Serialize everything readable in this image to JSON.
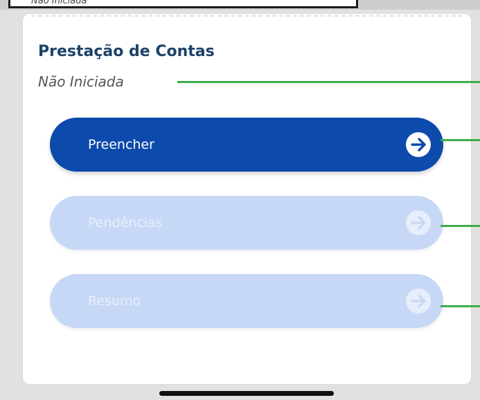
{
  "previous_card": {
    "status_text": "Não Iniciada"
  },
  "card": {
    "title": "Prestação de Contas",
    "status": "Não Iniciada"
  },
  "buttons": [
    {
      "label": "Preencher",
      "state": "enabled",
      "icon": "arrow-right-circle-icon"
    },
    {
      "label": "Pendências",
      "state": "disabled",
      "icon": "arrow-right-circle-icon"
    },
    {
      "label": "Resumo",
      "state": "disabled",
      "icon": "arrow-right-circle-icon"
    }
  ],
  "colors": {
    "primary": "#0c4aab",
    "disabled": "#c7d8f6",
    "title": "#1d4268",
    "annotation": "#3cae4a"
  }
}
